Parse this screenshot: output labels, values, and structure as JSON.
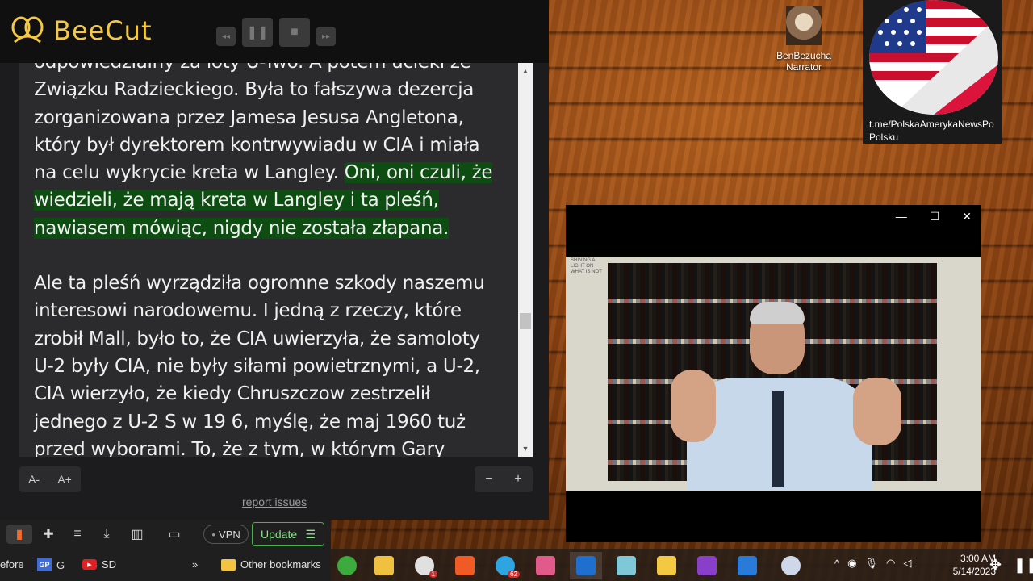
{
  "beecut": {
    "name": "BeeCut",
    "controls": {
      "rewind": "◂◂",
      "pause": "❚❚",
      "stop": "■",
      "forward": "▸▸"
    }
  },
  "reader": {
    "paragraph1_plain": "odpowiedzialny za loty U-Two. A potem ucieki ze Związku Radzieckiego. Była to fałszywa dezercja zorganizowana przez Jamesa Jesusa Angletona, który był dyrektorem kontrwywiadu w CIA i miała na celu wykrycie kreta w Langley.",
    "paragraph1_highlight": "Oni, oni czuli, że wiedzieli, że mają kreta w Langley i ta pleśń, nawiasem mówiąc, nigdy nie została złapana.",
    "paragraph2": "Ale ta pleśń wyrządziła ogromne szkody naszemu interesowi narodowemu. I jedną z rzeczy, które zrobił Mall, było to, że CIA uwierzyła, że samoloty U-2 były CIA, nie były siłami powietrznymi, a U-2, CIA wierzyło, że kiedy Chruszczow zestrzelił jednego z U-2 S w 19 6, myślę, że maj 1960 tuż przed wyborami. To, że z tym, w którym Gary",
    "font_decrease": "A-",
    "font_increase": "A+",
    "zoom_out": "−",
    "zoom_in": "+",
    "report_link": "report issues",
    "scroll_up": "▲",
    "scroll_down": "▼"
  },
  "desktop": {
    "narrator_icon_label": "BenBezucha Narrator",
    "flag_label_line1": "t.me/PolskaAmerykaNewsPo",
    "flag_label_line2": "Polsku"
  },
  "video_window": {
    "minimize": "—",
    "maximize": "☐",
    "close": "✕",
    "book_spine_text": "SHINING A LIGHT ON WHAT IS NOT"
  },
  "browser_toolbar": {
    "vpn_label": "VPN",
    "update_label": "Update",
    "menu_glyph": "☰"
  },
  "bookmarks": {
    "cutoff_label": "efore",
    "gp_icon_text": "GP",
    "g_label": "G",
    "yt_label": "SD",
    "more_glyph": "»",
    "other_bookmarks": "Other bookmarks"
  },
  "taskbar": {
    "badge_whatsapp": "1",
    "badge_telegram": "62",
    "time": "3:00 AM",
    "date": "5/14/2023",
    "tray_chevron": "^",
    "colors": {
      "start_green": "#3daa3d",
      "explorer_yellow": "#f0c040",
      "brave_orange": "#f05a24",
      "telegram_blue": "#2ca5e0",
      "bee_yellow": "#f3c843"
    }
  }
}
